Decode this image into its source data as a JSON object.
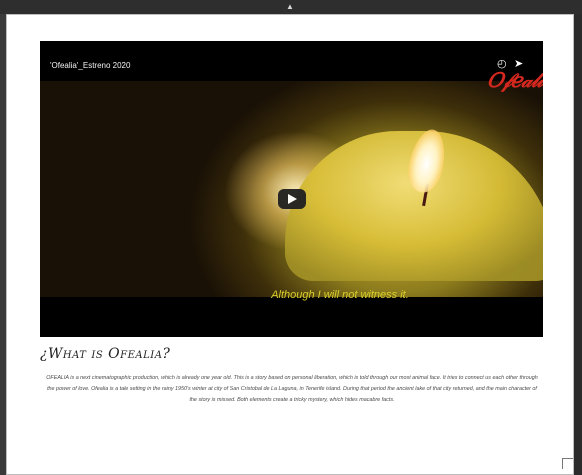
{
  "video": {
    "title": "'Ofealia'_Estreno 2020",
    "logo_text": "Ofealia",
    "subtitle": "Although I will not witness it.",
    "watch_later_icon": "clock-icon",
    "share_icon": "share-icon"
  },
  "section": {
    "heading": "¿What is Ofealia?",
    "body": "OFEALIA is a next cinematographic production, which is already one year old. This is a story based on personal liberation, which is told through our most animal face. It tries to connect us each other through the power of love. Ofealia is a tale setting in the rainy 1950's winter at city of San Cristobal de La Laguna, in Tenerife island. During that period the ancient lake of that city returned, and the main character of the story is missed. Both elements create a tricky mystery, which hides macabre facts."
  },
  "colors": {
    "logo": "#d6281f",
    "subtitle": "#d8cf2c"
  }
}
